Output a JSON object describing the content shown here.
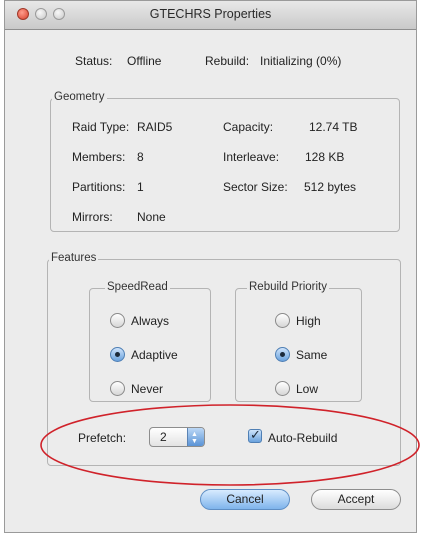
{
  "window": {
    "title": "GTECHRS Properties"
  },
  "status": {
    "status_label": "Status:",
    "status_value": "Offline",
    "rebuild_label": "Rebuild:",
    "rebuild_value": "Initializing (0%)"
  },
  "geometry": {
    "legend": "Geometry",
    "raid_type_label": "Raid Type:",
    "raid_type_value": "RAID5",
    "capacity_label": "Capacity:",
    "capacity_value": "12.74 TB",
    "members_label": "Members:",
    "members_value": "8",
    "interleave_label": "Interleave:",
    "interleave_value": "128 KB",
    "partitions_label": "Partitions:",
    "partitions_value": "1",
    "sector_size_label": "Sector Size:",
    "sector_size_value": "512 bytes",
    "mirrors_label": "Mirrors:",
    "mirrors_value": "None"
  },
  "features": {
    "legend": "Features",
    "speedread": {
      "legend": "SpeedRead",
      "options": [
        "Always",
        "Adaptive",
        "Never"
      ],
      "selected": "Adaptive"
    },
    "rebuild_priority": {
      "legend": "Rebuild Priority",
      "options": [
        "High",
        "Same",
        "Low"
      ],
      "selected": "Same"
    },
    "prefetch_label": "Prefetch:",
    "prefetch_value": "2",
    "auto_rebuild_label": "Auto-Rebuild",
    "auto_rebuild_checked": true
  },
  "buttons": {
    "cancel": "Cancel",
    "accept": "Accept"
  },
  "annotation": {
    "color": "#d0222a"
  }
}
